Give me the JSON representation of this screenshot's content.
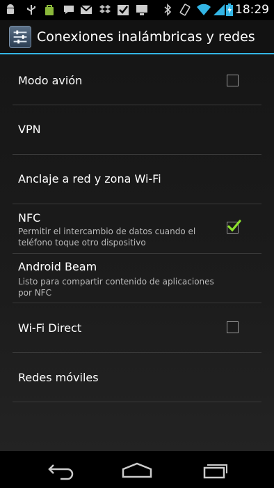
{
  "status_bar": {
    "time": "18:29",
    "icons": [
      "android-icon",
      "usb-icon",
      "market-icon",
      "message-icon",
      "gmail-icon",
      "dropbox-icon",
      "check-icon",
      "download-icon",
      "bluetooth-icon",
      "vibrate-icon",
      "wifi-icon",
      "signal-icon",
      "battery-charging-icon"
    ]
  },
  "action_bar": {
    "icon": "settings-icon",
    "title": "Conexiones inalámbricas y redes"
  },
  "settings": {
    "items": [
      {
        "title": "Modo avión",
        "summary": "",
        "checkbox": true,
        "checked": false
      },
      {
        "title": "VPN",
        "summary": "",
        "checkbox": false
      },
      {
        "title": "Anclaje a red y zona Wi-Fi",
        "summary": "",
        "checkbox": false
      },
      {
        "title": "NFC",
        "summary": "Permitir el intercambio de datos cuando el teléfono toque otro dispositivo",
        "checkbox": true,
        "checked": true
      },
      {
        "title": "Android Beam",
        "summary": "Listo para compartir contenido de aplicaciones por NFC",
        "checkbox": false
      },
      {
        "title": "Wi-Fi Direct",
        "summary": "",
        "checkbox": true,
        "checked": false
      },
      {
        "title": "Redes móviles",
        "summary": "",
        "checkbox": false
      }
    ]
  },
  "nav_bar": {
    "buttons": [
      "back-icon",
      "home-icon",
      "recent-apps-icon"
    ]
  },
  "colors": {
    "accent": "#33b5e5",
    "check": "#8ce12c"
  }
}
